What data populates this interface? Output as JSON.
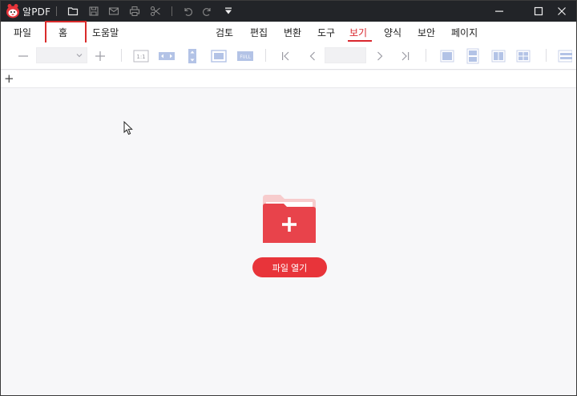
{
  "titlebar": {
    "app_name": "알PDF",
    "quick_access_icons": [
      "folder-open-icon",
      "save-icon",
      "mail-icon",
      "print-icon",
      "scissors-icon",
      "undo-icon",
      "redo-icon",
      "customize-down-icon"
    ],
    "window_controls": [
      "minimize-icon",
      "maximize-icon",
      "close-icon"
    ]
  },
  "menu": {
    "left": [
      {
        "label": "파일"
      },
      {
        "label": "홈"
      },
      {
        "label": "도움말"
      }
    ],
    "ribbon_tabs": [
      {
        "label": "검토"
      },
      {
        "label": "편집"
      },
      {
        "label": "변환"
      },
      {
        "label": "도구"
      },
      {
        "label": "보기",
        "active": true
      },
      {
        "label": "양식"
      },
      {
        "label": "보안"
      },
      {
        "label": "페이지"
      }
    ]
  },
  "toolbar": {
    "zoom_value": "",
    "page_value": "",
    "icons": [
      "zoom-out-icon",
      "zoom-in-icon",
      "actual-size-icon",
      "fit-width-icon",
      "fit-height-icon",
      "fit-page-icon",
      "full-screen-icon",
      "first-page-icon",
      "prev-page-icon",
      "next-page-icon",
      "last-page-icon",
      "single-page-icon",
      "continuous-icon",
      "two-page-icon",
      "grid-view-icon"
    ],
    "actual_size_text": "1:1",
    "full_text": "FULL"
  },
  "tabs": {
    "new_tab": "+"
  },
  "main": {
    "open_file_button": "파일 열기"
  },
  "colors": {
    "accent": "#d9272e",
    "titlebar": "#222428",
    "folder_back": "#f7cccd",
    "folder_front": "#e8434b"
  }
}
